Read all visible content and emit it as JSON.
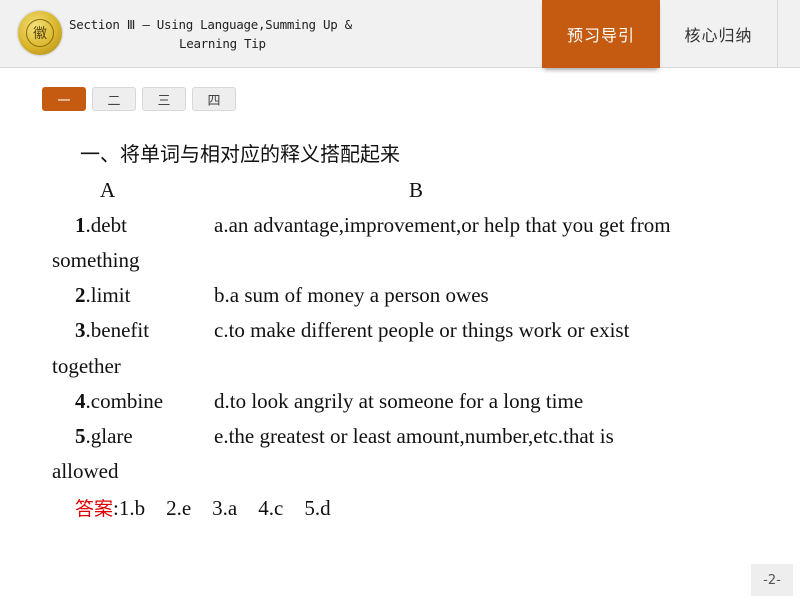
{
  "header": {
    "logo_icon": "school-emblem-icon",
    "logo_glyph": "徽",
    "title_line1": "Section Ⅲ — Using Language,Summing Up &",
    "title_line2": "Learning Tip",
    "tabs": [
      {
        "label": "预习导引",
        "active": true
      },
      {
        "label": "核心归纳",
        "active": false
      }
    ]
  },
  "subtabs": [
    {
      "label": "一",
      "active": true
    },
    {
      "label": "二",
      "active": false
    },
    {
      "label": "三",
      "active": false
    },
    {
      "label": "四",
      "active": false
    }
  ],
  "exercise": {
    "heading": "一、将单词与相对应的释义搭配起来",
    "col_a": "A",
    "col_b": "B",
    "items": [
      {
        "num": "1",
        "word": ".debt",
        "def": "a.an advantage,improvement,or  help that you get from",
        "wrap": "something"
      },
      {
        "num": "2",
        "word": ".limit",
        "def": "b.a sum of money a person owes",
        "wrap": ""
      },
      {
        "num": "3",
        "word": ".benefit",
        "def": "c.to make different people or things work or exist",
        "wrap": "together"
      },
      {
        "num": "4",
        "word": ".combine",
        "def": "d.to look angrily at someone for a long time",
        "wrap": ""
      },
      {
        "num": "5",
        "word": ".glare",
        "def": "e.the greatest or least amount,number,etc.that  is",
        "wrap": "allowed"
      }
    ],
    "answer_label": "答案",
    "answer_text": ":1.b    2.e    3.a    4.c    5.d"
  },
  "page_number": "-2-",
  "colors": {
    "accent": "#c55a11",
    "answer_red": "#e00000",
    "header_bg": "#f1f1f1"
  }
}
